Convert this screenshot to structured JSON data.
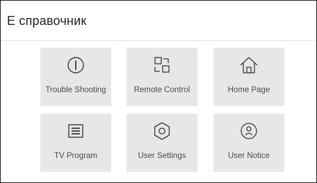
{
  "header": {
    "title": "Е справочник"
  },
  "colors": {
    "tile_background": "#e7e7e7",
    "icon_stroke": "#3a3a3a",
    "label_text": "#4a4a4a",
    "title_text": "#222222"
  },
  "tiles": [
    {
      "label": "Trouble Shooting",
      "icon": "exclamation-circle-icon"
    },
    {
      "label": "Remote Control",
      "icon": "remote-grid-icon"
    },
    {
      "label": "Home Page",
      "icon": "home-icon"
    },
    {
      "label": "TV Program",
      "icon": "list-icon"
    },
    {
      "label": "User Settings",
      "icon": "settings-hexagon-icon"
    },
    {
      "label": "User Notice",
      "icon": "user-notice-icon"
    }
  ]
}
